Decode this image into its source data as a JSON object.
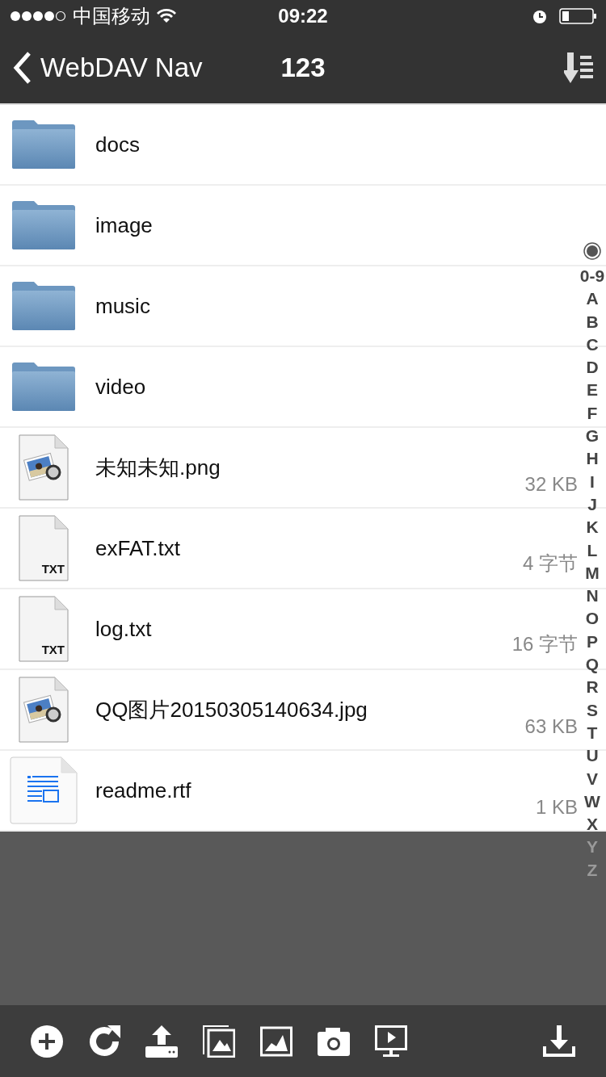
{
  "status_bar": {
    "carrier": "中国移动",
    "time": "09:22"
  },
  "nav": {
    "back": "WebDAV Nav",
    "title": "123"
  },
  "files": [
    {
      "kind": "folder",
      "name": "docs"
    },
    {
      "kind": "folder",
      "name": "image"
    },
    {
      "kind": "folder",
      "name": "music"
    },
    {
      "kind": "folder",
      "name": "video"
    },
    {
      "kind": "image",
      "name": "未知未知.png",
      "size": "32 KB"
    },
    {
      "kind": "text",
      "name": "exFAT.txt",
      "size": "4 字节",
      "icon_label": "TXT"
    },
    {
      "kind": "text",
      "name": "log.txt",
      "size": "16 字节",
      "icon_label": "TXT"
    },
    {
      "kind": "image",
      "name": "QQ图片20150305140634.jpg",
      "size": "63 KB"
    },
    {
      "kind": "rtf",
      "name": "readme.rtf",
      "size": "1 KB"
    }
  ],
  "index": [
    "0-9",
    "A",
    "B",
    "C",
    "D",
    "E",
    "F",
    "G",
    "H",
    "I",
    "J",
    "K",
    "L",
    "M",
    "N",
    "O",
    "P",
    "Q",
    "R",
    "S",
    "T",
    "U",
    "V",
    "W",
    "X",
    "Y",
    "Z"
  ],
  "toolbar": [
    {
      "kind": "add"
    },
    {
      "kind": "refresh"
    },
    {
      "kind": "upload"
    },
    {
      "kind": "photos"
    },
    {
      "kind": "image"
    },
    {
      "kind": "camera"
    },
    {
      "kind": "slideshow"
    },
    {
      "kind": "download"
    }
  ]
}
